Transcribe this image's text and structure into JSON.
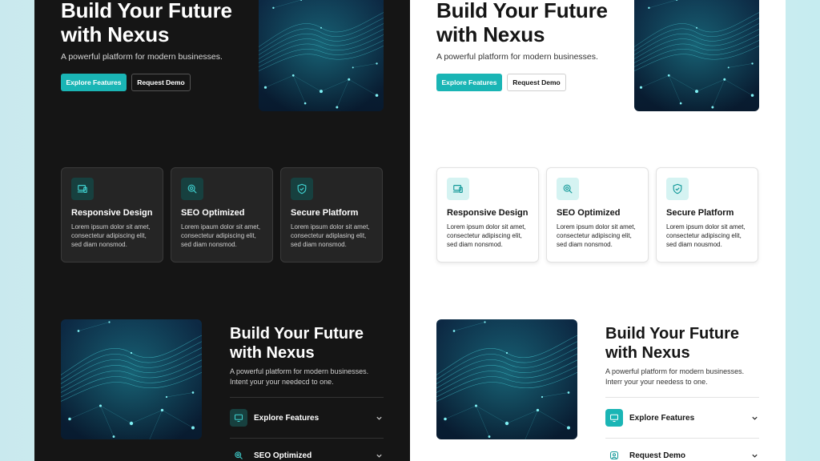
{
  "panels": [
    {
      "theme": "dark",
      "hero": {
        "title_line1": "Build Your Future",
        "title_line2": "with Nexus",
        "subtitle": "A powerful platform for modern businesses.",
        "primary_button": "Explore Features",
        "secondary_button": "Request Demo"
      },
      "features": [
        {
          "icon": "laptop-icon",
          "title": "Responsive Design",
          "text": "Lorem ipsum dolor sit amet, consectetur adipiscing elit, sed diam nonsmod."
        },
        {
          "icon": "search-icon",
          "title": "SEO Optimized",
          "text": "Lorem ipaum dolor sit amet, consectetur adipiscing elit, sed diam nonsmod."
        },
        {
          "icon": "shield-check-icon",
          "title": "Secure Platform",
          "text": "Lorem ipsum dolor sit amet, consectetur adiplasing elit, sed diam nonsmod."
        }
      ],
      "section": {
        "title_line1": "Build Your Future",
        "title_line2": "with Nexus",
        "subtitle_line1": "A powerful platform for modern businesses.",
        "subtitle_line2": "Intent your your needecd to one.",
        "accordion": [
          {
            "icon": "monitor-icon",
            "label": "Explore Features"
          },
          {
            "icon": "search-icon",
            "label": "SEO Optimized"
          }
        ]
      }
    },
    {
      "theme": "light",
      "hero": {
        "title_line1": "Build Your Future",
        "title_line2": "with Nexus",
        "subtitle": "A powerful platform for modern businesses.",
        "primary_button": "Explore Features",
        "secondary_button": "Request Demo"
      },
      "features": [
        {
          "icon": "laptop-icon",
          "title": "Responsive Design",
          "text": "Lorem ipsum dolor sit amet, consectetur adipiscing elit, sed diam nonsmod."
        },
        {
          "icon": "search-icon",
          "title": "SEO Optimized",
          "text": "Lorem ipsum dolor sit amet, consectetur adipiscing elit, sed diam nonsmod."
        },
        {
          "icon": "shield-check-icon",
          "title": "Secure Platform",
          "text": "Lorem ipsum dolor sit amet, consectetur adipiscing elit, sed diam nousmod."
        }
      ],
      "section": {
        "title_line1": "Build Your Future",
        "title_line2": "with Nexus",
        "subtitle_line1": "A powerful platform for modern businesses.",
        "subtitle_line2": "Interr your your needess to one.",
        "accordion": [
          {
            "icon": "monitor-icon",
            "label": "Explore Features"
          },
          {
            "icon": "user-icon",
            "label": "Request Demo"
          }
        ]
      }
    }
  ],
  "colors": {
    "accent": "#1ab5b5",
    "dark_bg": "#151515",
    "light_bg": "#ffffff"
  }
}
